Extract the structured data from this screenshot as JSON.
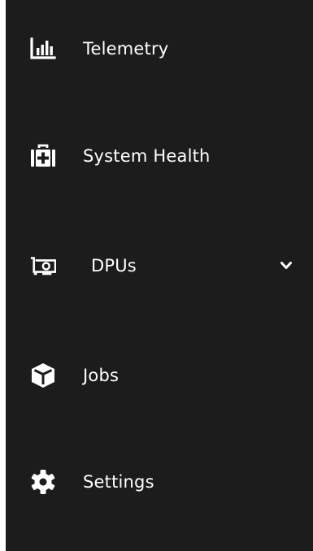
{
  "sidebar": {
    "items": [
      {
        "label": "Telemetry",
        "icon": "bar-chart-icon"
      },
      {
        "label": "System Health",
        "icon": "first-aid-kit-icon"
      },
      {
        "label": "DPUs",
        "icon": "network-card-icon",
        "expandable": true
      },
      {
        "label": "Jobs",
        "icon": "cube-icon"
      },
      {
        "label": "Settings",
        "icon": "gear-icon"
      }
    ]
  },
  "colors": {
    "sidebar_bg": "#1c1c1c",
    "text": "#ffffff"
  }
}
